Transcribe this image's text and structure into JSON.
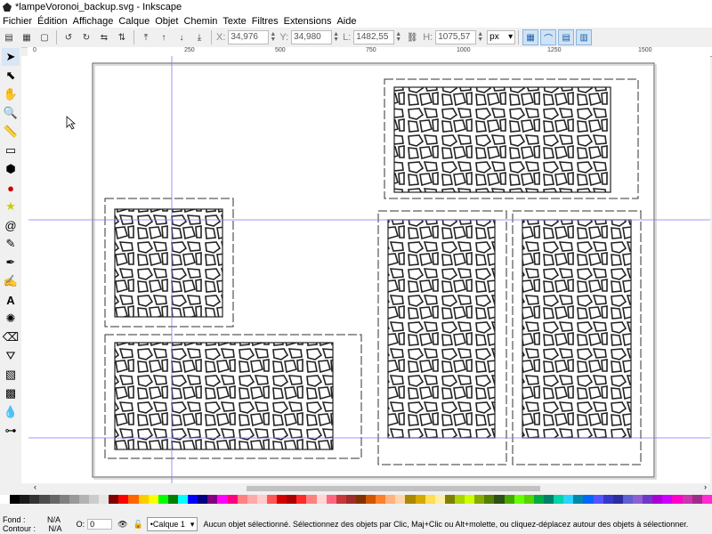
{
  "window": {
    "title": "*lampeVoronoi_backup.svg - Inkscape"
  },
  "menu": [
    "Fichier",
    "Édition",
    "Affichage",
    "Calque",
    "Objet",
    "Chemin",
    "Texte",
    "Filtres",
    "Extensions",
    "Aide"
  ],
  "toolbar": {
    "x_label": "X:",
    "x_value": "34,976",
    "y_label": "Y:",
    "y_value": "34,980",
    "w_label": "L:",
    "w_value": "1482,55",
    "h_label": "H:",
    "h_value": "1075,57",
    "unit": "px"
  },
  "ruler": {
    "labels": [
      "0",
      "250",
      "500",
      "750",
      "1000",
      "1250",
      "1500"
    ]
  },
  "status": {
    "fill_label": "Fond :",
    "fill_value": "N/A",
    "stroke_label": "Contour :",
    "stroke_value": "N/A",
    "opacity_label": "O:",
    "opacity_value": "0",
    "layer": "•Calque 1",
    "message": "Aucun objet sélectionné. Sélectionnez des objets par Clic, Maj+Clic ou Alt+molette, ou cliquez-déplacez autour des objets à sélectionner."
  },
  "palette": [
    "#ffffff",
    "#000000",
    "#1a1a1a",
    "#333333",
    "#4d4d4d",
    "#666666",
    "#808080",
    "#999999",
    "#b3b3b3",
    "#cccccc",
    "#e6e6e6",
    "#800000",
    "#ff0000",
    "#ff6600",
    "#ffcc00",
    "#ffff00",
    "#00ff00",
    "#008000",
    "#00ffff",
    "#0000ff",
    "#000080",
    "#800080",
    "#ff00ff",
    "#ff0080",
    "#ff8080",
    "#ffaaaa",
    "#ffcccc",
    "#ff5555",
    "#d40000",
    "#aa0000",
    "#ff2a2a",
    "#ff8080",
    "#ffd5d5",
    "#ff6680",
    "#c83737",
    "#a02c2c",
    "#803300",
    "#d45500",
    "#ff7f2a",
    "#ffb380",
    "#ffd5b0",
    "#aa8800",
    "#d4aa00",
    "#ffdd55",
    "#ffeeaa",
    "#808000",
    "#aad400",
    "#ccff00",
    "#88aa00",
    "#558000",
    "#2d5016",
    "#44aa00",
    "#66ff00",
    "#55d400",
    "#00aa44",
    "#008066",
    "#00d4aa",
    "#2ad4ff",
    "#0088aa",
    "#0066ff",
    "#5555ff",
    "#3737c8",
    "#2c2ca0",
    "#5f5fd3",
    "#8d5fd3",
    "#7137c8",
    "#aa00d4",
    "#cc00ff",
    "#ff00cc",
    "#c837ab",
    "#a02c89",
    "#ff2ad4"
  ]
}
